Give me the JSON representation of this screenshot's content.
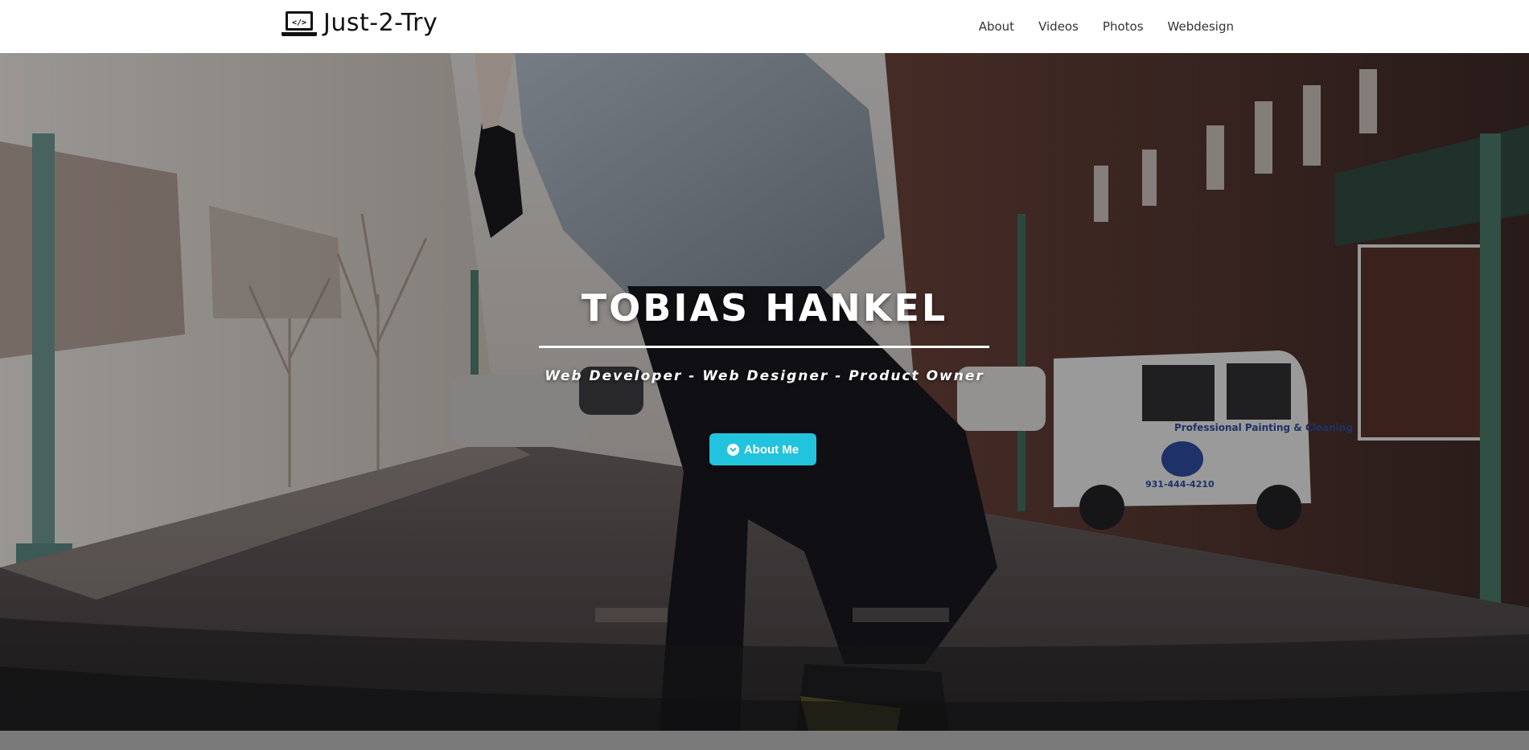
{
  "header": {
    "brand": "Just-2-Try",
    "brand_icon": "laptop-code-icon",
    "nav": [
      {
        "label": "About"
      },
      {
        "label": "Videos"
      },
      {
        "label": "Photos"
      },
      {
        "label": "Webdesign"
      }
    ]
  },
  "hero": {
    "title": "TOBIAS HANKEL",
    "subtitle": "Web Developer - Web Designer - Product Owner",
    "button": {
      "label": "About Me",
      "icon": "chevron-circle-down-icon"
    }
  },
  "colors": {
    "accent": "#22c3dc",
    "navbar_bg": "#ffffff",
    "text_light": "#ffffff"
  }
}
